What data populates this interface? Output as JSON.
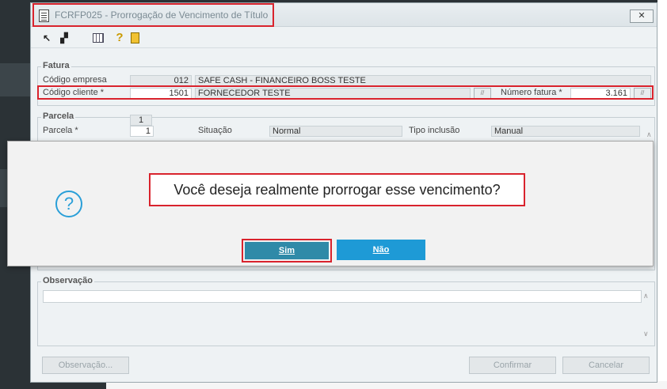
{
  "window": {
    "title": "FCRFP025 - Prorrogação de Vencimento de Título",
    "close_label": "✕"
  },
  "toolbar": {
    "icons": [
      "arrow-nw-icon",
      "copy-icon",
      "calendar-grid-icon",
      "help-icon",
      "exit-door-icon"
    ]
  },
  "fatura": {
    "legend": "Fatura",
    "codigo_empresa_label": "Código empresa",
    "codigo_empresa_value": "012",
    "empresa_nome": "SAFE CASH - FINANCEIRO BOSS TESTE",
    "codigo_cliente_label": "Código cliente *",
    "codigo_cliente_value": "1501",
    "cliente_nome": "FORNECEDOR TESTE",
    "numero_fatura_label": "Número fatura *",
    "numero_fatura_value": "3.161"
  },
  "parcela": {
    "legend": "Parcela",
    "counter": "1",
    "parcela_label": "Parcela *",
    "parcela_value": "1",
    "situacao_label": "Situação",
    "situacao_value": "Normal",
    "tipo_inclusao_label": "Tipo inclusão",
    "tipo_inclusao_value": "Manual"
  },
  "observacao": {
    "legend": "Observação"
  },
  "footer": {
    "observacao_button": "Observação...",
    "confirmar_button": "Confirmar",
    "cancelar_button": "Cancelar"
  },
  "dialog": {
    "icon": "question-icon",
    "message": "Você deseja realmente prorrogar esse vencimento?",
    "sim_label": "Sim",
    "nao_label": "Não"
  },
  "colors": {
    "highlight": "#d9232d",
    "sim_button": "#2f8aa8",
    "nao_button": "#1e9ad6",
    "question_icon": "#2a9fd8"
  }
}
